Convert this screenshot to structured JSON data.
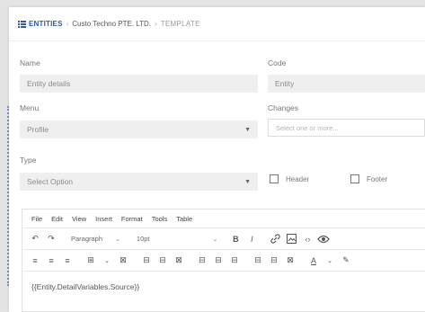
{
  "breadcrumb": {
    "root": "ENTITIES",
    "org": "Custo Techno PTE. LTD.",
    "leaf": "TEMPLATE"
  },
  "form": {
    "name": {
      "label": "Name",
      "value": "Entity details"
    },
    "code": {
      "label": "Code",
      "value": "Entity"
    },
    "menu": {
      "label": "Menu",
      "value": "Profile"
    },
    "changes": {
      "label": "Changes",
      "placeholder": "Select one or more..."
    },
    "type": {
      "label": "Type",
      "value": "Select Option"
    },
    "header_checkbox": {
      "label": "Header",
      "checked": false
    },
    "footer_checkbox": {
      "label": "Footer",
      "checked": false
    }
  },
  "editor": {
    "menu": [
      "File",
      "Edit",
      "View",
      "Insert",
      "Format",
      "Tools",
      "Table"
    ],
    "format_value": "Paragraph",
    "size_value": "10pt",
    "content": "{{Entity.DetailVariables.Source}}"
  },
  "colors": {
    "accent": "#2f58a8",
    "field_bg": "#efefef",
    "rail": "#7a8fc4"
  }
}
